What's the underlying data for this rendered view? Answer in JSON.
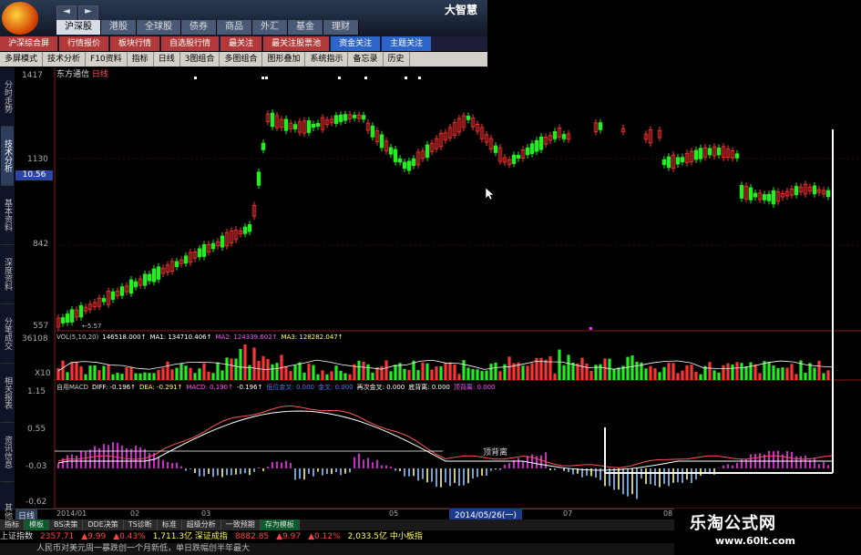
{
  "app": {
    "brand": "大智慧",
    "nav_back": "◄",
    "nav_fwd": "►",
    "home_icon": "home-icon"
  },
  "tabs": [
    "沪深股",
    "港股",
    "全球股",
    "债券",
    "商品",
    "外汇",
    "基金",
    "理财"
  ],
  "row2": [
    "沪深综合屏",
    "行情报价",
    "板块行情",
    "自选股行情",
    "最关注",
    "最关注股票池",
    "资金关注",
    "主题关注"
  ],
  "row3": [
    "多屏模式",
    "技术分析",
    "F10资料",
    "指标",
    "日线",
    "3图组合",
    "多图组合",
    "图形叠加",
    "系统指示",
    "备忘录",
    "历史"
  ],
  "left_tabs": [
    "分时走势",
    "技术分析",
    "基本资料",
    "深度资料",
    "分笔成交",
    "相关报表",
    "资讯信息",
    "其他"
  ],
  "stock": {
    "name": "东方通信",
    "period": "日线"
  },
  "price_axis": [
    "1417",
    "1130",
    "842",
    "557"
  ],
  "current_price": "10.56",
  "low_marker": "5.57",
  "vol_axis": [
    "36108",
    "X10"
  ],
  "vol_info": [
    {
      "text": "VOL(5,10,20)",
      "color": "#cccccc"
    },
    {
      "text": "146518.000↑",
      "color": "#ffffff"
    },
    {
      "text": "MA1: 134710.406↑",
      "color": "#ffffff"
    },
    {
      "text": "MA2: 124339.602↑",
      "color": "#ff55ff"
    },
    {
      "text": "MA3: 128282.047↑",
      "color": "#ffff55"
    }
  ],
  "macd_axis": [
    "1.15",
    "0.55",
    "-0.03",
    "-0.62"
  ],
  "macd_info": [
    {
      "text": "自用MACD",
      "color": "#cccccc"
    },
    {
      "text": "DIFF: -0.196↑",
      "color": "#ffffff"
    },
    {
      "text": "DEA: -0.291↑",
      "color": "#ffff55"
    },
    {
      "text": "MACD: 0.190↑",
      "color": "#ff55ff"
    },
    {
      "text": "-0.196↑",
      "color": "#ffffff"
    },
    {
      "text": "低位金叉: 0.000",
      "color": "#5577ff"
    },
    {
      "text": "金叉: 0.000",
      "color": "#5577ff"
    },
    {
      "text": "再次金叉: 0.000",
      "color": "#ffffff"
    },
    {
      "text": "底背离: 0.000",
      "color": "#ffffff"
    },
    {
      "text": "顶背离: 0.000",
      "color": "#ff55ff"
    }
  ],
  "macd_annotation": "顶背离",
  "time_axis": {
    "period_label": "日线",
    "ticks": [
      "2014/01",
      "02",
      "03",
      "05",
      "07",
      "08"
    ],
    "cursor_date": "2014/05/26(一)"
  },
  "bottom_tabs": [
    "指标",
    "模板",
    "BS决策",
    "DDE决策",
    "TS诊断",
    "标准",
    "超级分析",
    "一致预期",
    "存为模板"
  ],
  "ticker": [
    {
      "text": "上证指数",
      "color": "#dddddd"
    },
    {
      "text": "2357.71",
      "color": "#ff4444"
    },
    {
      "text": "▲9.99",
      "color": "#ff4444"
    },
    {
      "text": "▲0.43%",
      "color": "#ff4444"
    },
    {
      "text": "1,711.3亿 深证成指",
      "color": "#ffff55"
    },
    {
      "text": "8882.85",
      "color": "#ff4444"
    },
    {
      "text": "▲9.97",
      "color": "#ff4444"
    },
    {
      "text": "▲0.12%",
      "color": "#ff4444"
    },
    {
      "text": "2,033.5亿 中小板指",
      "color": "#ffff55"
    }
  ],
  "news": "人民币对美元周一暴跌创一个月新低，单日跌幅创半年最大",
  "watermark": {
    "title": "乐淘公式网",
    "url": "www.60lt.com"
  },
  "colors": {
    "up": "#ff3333",
    "down": "#22ee22",
    "macd_pos": "#ff33ff",
    "macd_neg": "#8ec8ff",
    "macd_neg2": "#ffff88"
  }
}
